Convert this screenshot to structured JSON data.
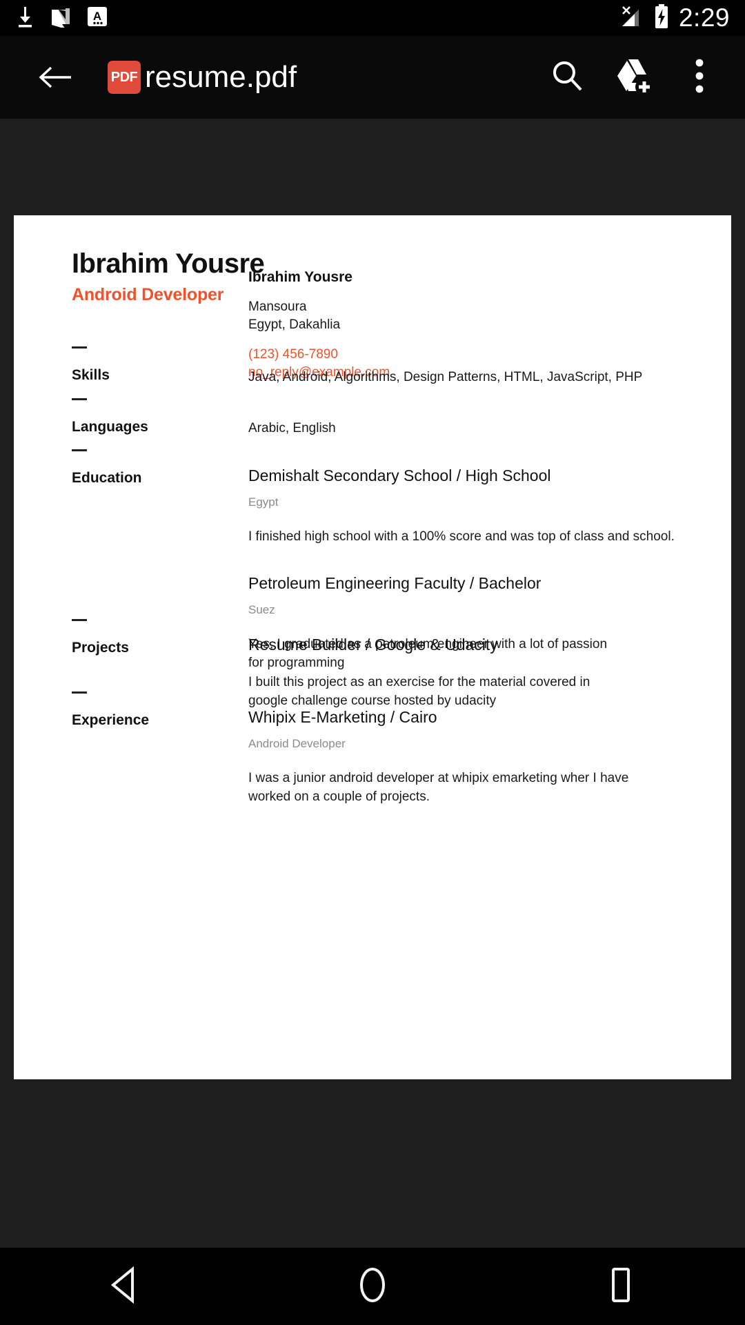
{
  "status_bar": {
    "left_icons": [
      {
        "name": "download-icon"
      },
      {
        "name": "android-nougat-icon"
      },
      {
        "name": "keyboard-input-icon",
        "glyph": "A"
      }
    ],
    "right_icons": [
      {
        "name": "no-signal-icon"
      },
      {
        "name": "battery-charging-icon"
      }
    ],
    "clock": "2:29"
  },
  "toolbar": {
    "back_label": "Back",
    "file_type_badge": "PDF",
    "file_name": "resume.pdf",
    "search_label": "Search",
    "add_to_drive_label": "Add to Drive",
    "more_options_label": "More options"
  },
  "colors": {
    "accent": "#F0532B",
    "pdf_badge": "#E04A3A",
    "viewer_background": "#1E1E1E",
    "toolbar_background": "#0A0A0A",
    "page_background": "#FFFFFF",
    "muted_text": "#8B8B8B"
  },
  "document": {
    "header": {
      "name": "Ibrahim Yousre",
      "role": "Android Developer"
    },
    "contact": {
      "name": "Ibrahim Yousre",
      "city": "Mansoura",
      "region": "Egypt, Dakahlia",
      "phone": "(123) 456-7890",
      "email": "no_reply@example.com"
    },
    "sections": [
      {
        "title": "Skills",
        "simple_text": "Java, Android, Algorithms, Design Patterns, HTML, JavaScript, PHP",
        "entries": []
      },
      {
        "title": "Languages",
        "simple_text": "Arabic, English",
        "entries": []
      },
      {
        "title": "Education",
        "simple_text": "",
        "entries": [
          {
            "title": "Demishalt Secondary School / High School",
            "subtitle": "Egypt",
            "description": "I finished high school with a 100% score and was top of class and school."
          },
          {
            "title": "Petroleum Engineering Faculty / Bachelor",
            "subtitle": "Suez",
            "description": "Yes, I graduated as a petroleum engineer with a lot of passion for programming"
          }
        ]
      },
      {
        "title": "Projects",
        "simple_text": "",
        "entries": [
          {
            "title": "Resume Builder / Google & Udacity",
            "subtitle": "",
            "description": "I built this project as an exercise for the material covered in google challenge course hosted by udacity"
          }
        ]
      },
      {
        "title": "Experience",
        "simple_text": "",
        "entries": [
          {
            "title": "Whipix E-Marketing / Cairo",
            "subtitle": "Android Developer",
            "description": "I was a junior android developer at whipix emarketing wher I have worked on a couple of projects."
          }
        ]
      }
    ]
  },
  "nav_bar": {
    "back_label": "Back",
    "home_label": "Home",
    "recents_label": "Recents"
  }
}
